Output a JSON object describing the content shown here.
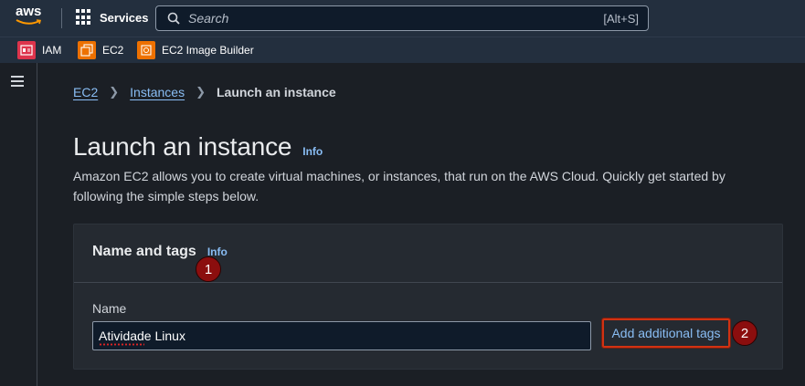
{
  "header": {
    "logo_text": "aws",
    "services_label": "Services",
    "search": {
      "placeholder": "Search",
      "shortcut": "[Alt+S]"
    }
  },
  "favorites": [
    {
      "label": "IAM",
      "color": "#dd344c"
    },
    {
      "label": "EC2",
      "color": "#ed7100"
    },
    {
      "label": "EC2 Image Builder",
      "color": "#ed7100"
    }
  ],
  "breadcrumb": {
    "items": [
      "EC2",
      "Instances"
    ],
    "current": "Launch an instance"
  },
  "page": {
    "title": "Launch an instance",
    "info": "Info",
    "description": "Amazon EC2 allows you to create virtual machines, or instances, that run on the AWS Cloud. Quickly get started by following the simple steps below."
  },
  "card": {
    "title": "Name and tags",
    "info": "Info",
    "name_label": "Name",
    "name_value": "Atividade Linux",
    "add_tags_label": "Add additional tags"
  },
  "annotations": {
    "badge_1": "1",
    "badge_2": "2"
  },
  "colors": {
    "accent_link": "#89bdf4",
    "highlight_border": "#d13212",
    "badge": "#8b0e0e"
  }
}
